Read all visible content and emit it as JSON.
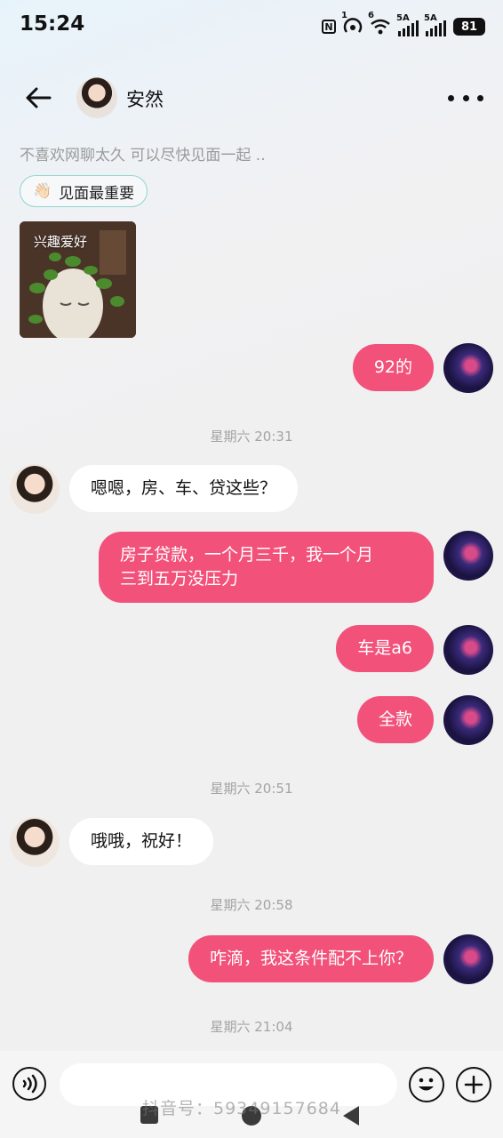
{
  "status_bar": {
    "time": "15:24",
    "nfc": "N",
    "hotspot_count": "1",
    "wifi_count": "6",
    "sim1": "5A",
    "sim2": "5A",
    "battery": "81"
  },
  "header": {
    "contact_name": "安然"
  },
  "profile": {
    "bio": "不喜欢网聊太久 可以尽快见面一起 ..",
    "tag": {
      "icon": "waving-hand-icon",
      "label": "见面最重要"
    },
    "photo_label": "兴趣爱好"
  },
  "messages": [
    {
      "dir": "out",
      "text": "92的"
    },
    {
      "type": "time",
      "text": "星期六 20:31"
    },
    {
      "dir": "in",
      "text": "嗯嗯，房、车、贷这些？"
    },
    {
      "dir": "out",
      "lines": [
        "房子贷款，一个月三千，我一个月",
        "三到五万没压力"
      ]
    },
    {
      "dir": "out",
      "text": "车是a6"
    },
    {
      "dir": "out",
      "text": "全款"
    },
    {
      "type": "time",
      "text": "星期六 20:51"
    },
    {
      "dir": "in",
      "text": "哦哦，祝好！"
    },
    {
      "type": "time",
      "text": "星期六 20:58"
    },
    {
      "dir": "out",
      "text": "咋滴，我这条件配不上你？"
    },
    {
      "type": "time",
      "text": "星期六 21:04"
    }
  ],
  "watermark": "抖音号：59349157684",
  "colors": {
    "outgoing_bubble": "#f2517a",
    "incoming_bubble": "#ffffff",
    "tag_border": "#8fd6d0"
  }
}
